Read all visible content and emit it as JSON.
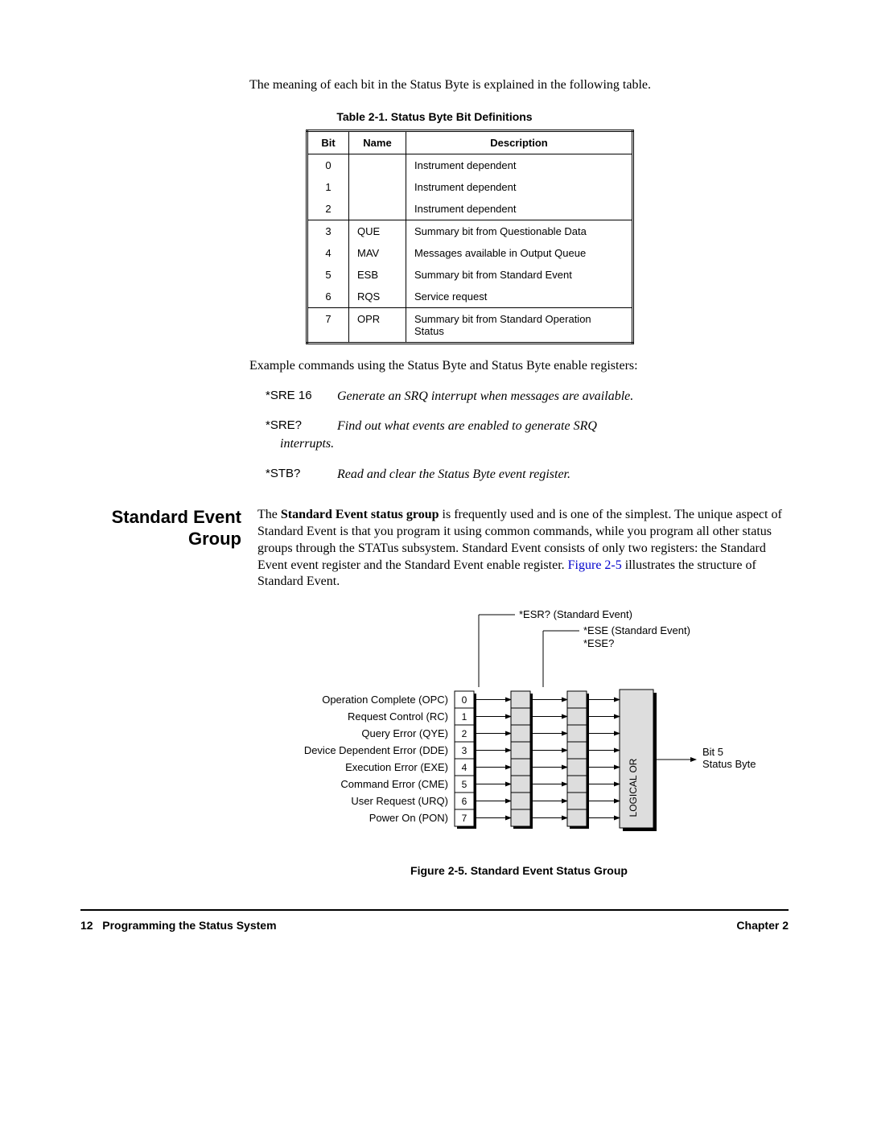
{
  "intro": "The meaning of each bit in the Status Byte is explained in the following table.",
  "table": {
    "caption": "Table 2-1. Status Byte Bit Definitions",
    "headers": {
      "bit": "Bit",
      "name": "Name",
      "desc": "Description"
    },
    "rows": [
      {
        "bit": "0",
        "name": "",
        "desc": "Instrument dependent"
      },
      {
        "bit": "1",
        "name": "",
        "desc": "Instrument dependent"
      },
      {
        "bit": "2",
        "name": "",
        "desc": "Instrument dependent"
      },
      {
        "bit": "3",
        "name": "QUE",
        "desc": "Summary bit from Questionable Data"
      },
      {
        "bit": "4",
        "name": "MAV",
        "desc": "Messages available in Output Queue"
      },
      {
        "bit": "5",
        "name": "ESB",
        "desc": "Summary bit from Standard Event"
      },
      {
        "bit": "6",
        "name": "RQS",
        "desc": "Service request"
      },
      {
        "bit": "7",
        "name": "OPR",
        "desc": "Summary bit from Standard Operation Status"
      }
    ]
  },
  "example_intro": "Example commands using the Status Byte and Status Byte enable registers:",
  "commands": [
    {
      "cmd": "*SRE 16",
      "desc": "Generate an SRQ interrupt when messages are available.",
      "cont": ""
    },
    {
      "cmd": "*SRE?",
      "desc": "Find out what events are enabled to generate SRQ",
      "cont": "interrupts."
    },
    {
      "cmd": "*STB?",
      "desc": "Read and clear the Status Byte event register.",
      "cont": ""
    }
  ],
  "section": {
    "heading": "Standard Event Group",
    "body_pre": "The ",
    "body_bold": "Standard Event status group",
    "body_mid": " is frequently used and is one of the simplest.  The unique aspect of Standard Event is that you program it using common commands, while you program all other status groups through the STATus subsystem.  Standard Event consists of only two registers: the Standard Event event register and the Standard Event enable register.  ",
    "link": "Figure 2-5",
    "body_post": " illustrates the structure of Standard Event."
  },
  "figure": {
    "caption": "Figure 2-5. Standard Event Status Group",
    "top_labels": {
      "esr": "*ESR? (Standard Event)",
      "ese": "*ESE (Standard Event)",
      "eseq": "*ESE?"
    },
    "rows": [
      {
        "label": "Operation Complete (OPC)",
        "bit": "0"
      },
      {
        "label": "Request Control  (RC)",
        "bit": "1"
      },
      {
        "label": "Query Error (QYE)",
        "bit": "2"
      },
      {
        "label": "Device Dependent Error (DDE)",
        "bit": "3"
      },
      {
        "label": "Execution Error (EXE)",
        "bit": "4"
      },
      {
        "label": "Command Error (CME)",
        "bit": "5"
      },
      {
        "label": "User Request (URQ)",
        "bit": "6"
      },
      {
        "label": "Power On (PON)",
        "bit": "7"
      }
    ],
    "logical": "LOGICAL OR",
    "out_top": "Bit 5",
    "out_bottom": "Status Byte"
  },
  "footer": {
    "left_page": "12",
    "left_title": "Programming the Status System",
    "right": "Chapter 2"
  }
}
